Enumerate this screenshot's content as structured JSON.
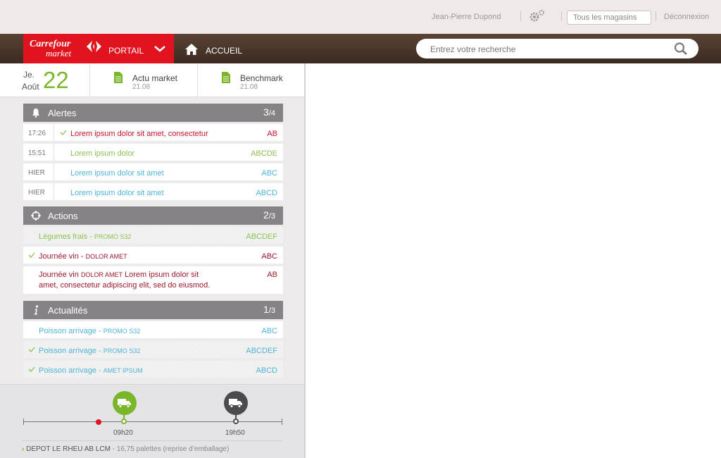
{
  "topbar": {
    "user_name": "Jean-Pierre Dupond",
    "store_select": "Tous les magasins",
    "logout": "Déconnexion"
  },
  "nav": {
    "brand_line1": "Carrefour",
    "brand_line2": "market",
    "portal_label": "PORTAIL",
    "home_label": "ACCUEIL",
    "search_placeholder": "Entrez votre recherche"
  },
  "date": {
    "day_abbr": "Je.",
    "month": "Août",
    "day_number": "22"
  },
  "docs": [
    {
      "title": "Actu market",
      "date": "21.08"
    },
    {
      "title": "Benchmark",
      "date": "21.08"
    }
  ],
  "alerts": {
    "title": "Alertes",
    "count": "3",
    "total": "/4",
    "rows": [
      {
        "time": "17:26",
        "text": "Lorem ipsum dolor sit amet, consectetur",
        "code": "AB",
        "checked": true
      },
      {
        "time": "15:51",
        "text": "Lorem ipsum dolor",
        "code": "ABCDE",
        "checked": false
      },
      {
        "time": "HIER",
        "text": "Lorem ipsum dolor sit amet",
        "code": "ABC",
        "checked": false
      },
      {
        "time": "HIER",
        "text": "Lorem ipsum dolor sit amet",
        "code": "ABCD",
        "checked": false
      }
    ]
  },
  "actions": {
    "title": "Actions",
    "count": "2",
    "total": "/3",
    "rows": [
      {
        "text": "Légumes frais - ",
        "tag": "PROMO S32",
        "code": "ABCDEF",
        "checked": false
      },
      {
        "text": "Journée vin - ",
        "tag": "DOLOR AMET",
        "code": "ABC",
        "checked": true
      },
      {
        "text_a": "Journée vin ",
        "tag": "DOLOR AMET",
        "text_b": " Lorem ipsum dolor sit",
        "text_c": "amet, consectetur adipiscing elit, sed do eiusmod.",
        "code": "AB",
        "checked": false
      }
    ]
  },
  "news": {
    "title": "Actualités",
    "count": "1",
    "total": "/3",
    "rows": [
      {
        "text": "Poisson arrivage - ",
        "tag": "PROMO S32",
        "code": "ABC",
        "checked": false
      },
      {
        "text": "Poisson arrivage - ",
        "tag": "PROMO S32",
        "code": "ABCDEF",
        "checked": true
      },
      {
        "text": "Poisson arrivage - ",
        "tag": "AMET IPSUM",
        "code": "ABCD",
        "checked": true
      }
    ]
  },
  "timeline": {
    "times": [
      "09h20",
      "19h50"
    ],
    "depot_main": "DEPOT LE RHEU AB LCM",
    "depot_detail": " - 16,75 palettes (reprise d’emballage)"
  },
  "colors": {
    "brand_red": "#e0131f",
    "nav_brown": "#4a362b",
    "green": "#7ab62a",
    "alert_red": "#c8102e",
    "blue": "#4fb3d9",
    "header_grey": "#858386"
  }
}
